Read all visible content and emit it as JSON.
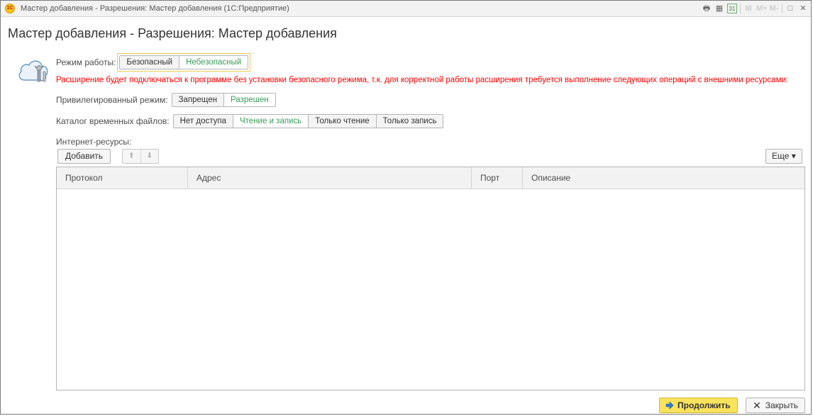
{
  "window": {
    "title": "Мастер добавления - Разрешения: Мастер добавления  (1С:Предприятие)",
    "logo_text": "1С",
    "tools": [
      "print-icon",
      "calculator-icon",
      "calendar-icon",
      "m-icon",
      "m-plus-icon",
      "m-minus-icon",
      "maximize-icon",
      "close-icon"
    ],
    "tool_glyphs": [
      "🖶",
      "▦",
      "31",
      "M",
      "M+",
      "M-",
      "□",
      "✕"
    ]
  },
  "form": {
    "title": "Мастер добавления - Разрешения: Мастер добавления"
  },
  "mode": {
    "label": "Режим работы:",
    "options": [
      "Безопасный",
      "Небезопасный"
    ],
    "selected": "Небезопасный"
  },
  "warning": "Расширение будет подключаться к программе без установки безопасного режима, т.к. для корректной работы расширения требуется выполнение следующих операций с внешними ресурсами:",
  "privileged": {
    "label": "Привилегированный режим:",
    "options": [
      "Запрещен",
      "Разрешен"
    ],
    "selected": "Разрешен"
  },
  "temp_dir": {
    "label": "Каталог временных файлов:",
    "options": [
      "Нет доступа",
      "Чтение и запись",
      "Только чтение",
      "Только запись"
    ],
    "selected": "Чтение и запись"
  },
  "internet": {
    "label": "Интернет-ресурсы:",
    "add_label": "Добавить",
    "more_label": "Еще ▾",
    "up_glyph": "⬆",
    "down_glyph": "⬇",
    "columns": [
      "Протокол",
      "Адрес",
      "Порт",
      "Описание"
    ],
    "rows": []
  },
  "footer": {
    "continue_label": "Продолжить",
    "close_label": "Закрыть",
    "close_glyph": "✕"
  },
  "colors": {
    "accent_yellow": "#fbe35c",
    "warning_red": "#ff0000",
    "selected_green": "#3a9b58",
    "focus_outline": "#f2c94c"
  }
}
